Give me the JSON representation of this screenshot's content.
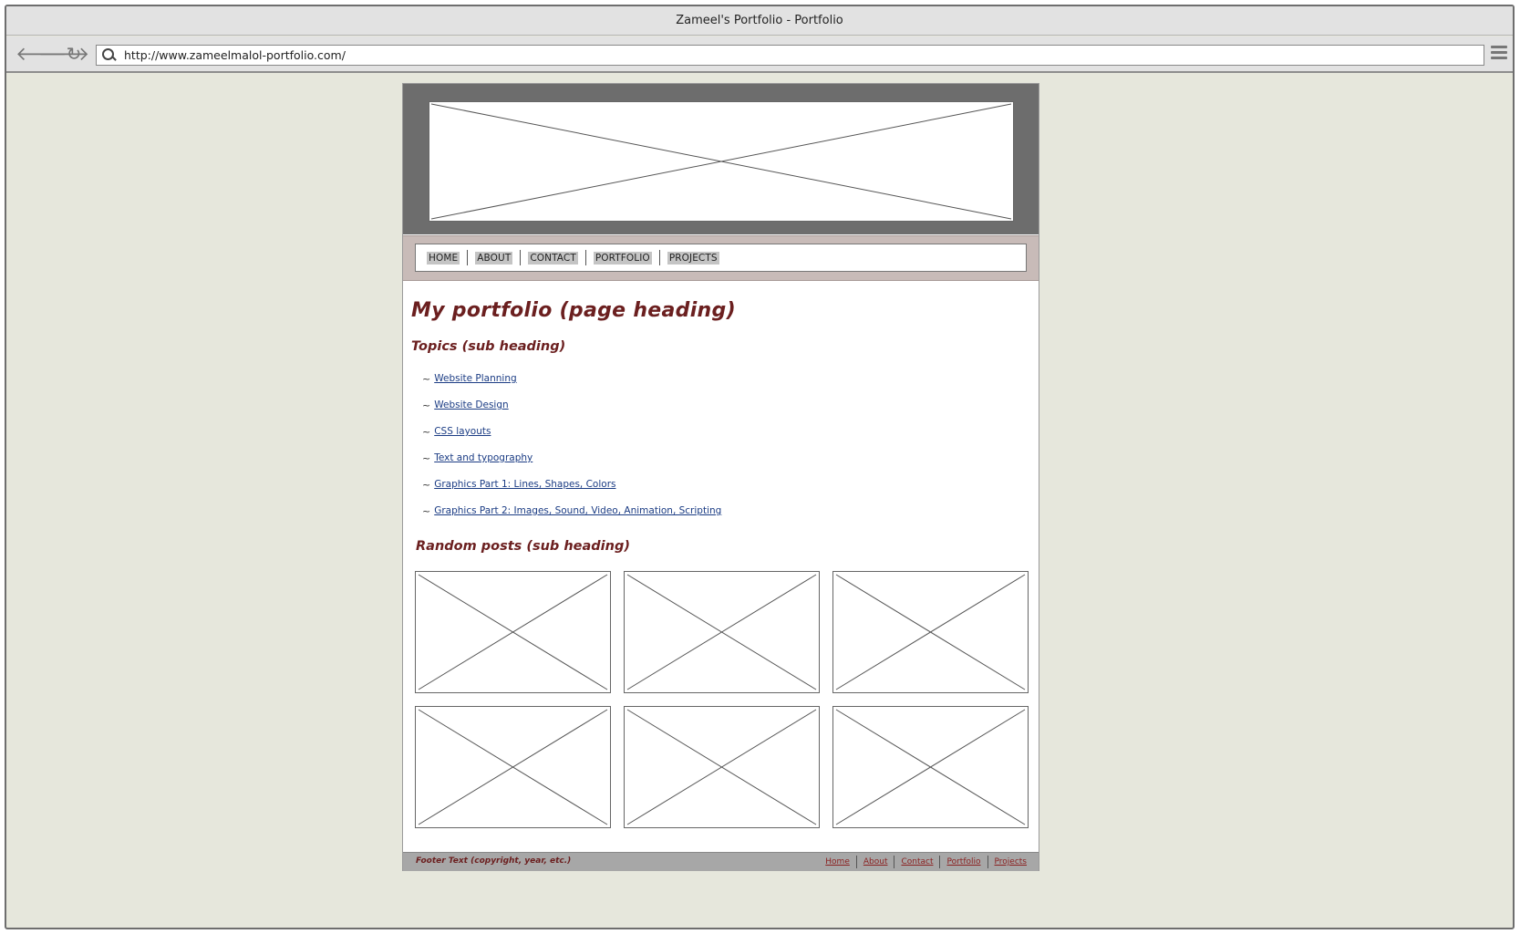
{
  "window": {
    "title": "Zameel's Portfolio - Portfolio"
  },
  "toolbar": {
    "url": "http://www.zameelmalol-portfolio.com/",
    "back_icon": "arrow-left-icon",
    "forward_icon": "arrow-right-icon",
    "reload_icon": "reload-icon",
    "menu_icon": "hamburger-menu-icon"
  },
  "nav": {
    "items": [
      {
        "label": "HOME"
      },
      {
        "label": "ABOUT"
      },
      {
        "label": "CONTACT"
      },
      {
        "label": "PORTFOLIO"
      },
      {
        "label": "PROJECTS"
      }
    ]
  },
  "main": {
    "heading": "My portfolio (page heading)",
    "topics_heading": "Topics (sub heading)",
    "topics": [
      {
        "bullet": "~",
        "label": "Website Planning"
      },
      {
        "bullet": "~",
        "label": "Website Design"
      },
      {
        "bullet": "~",
        "label": "CSS layouts"
      },
      {
        "bullet": "~",
        "label": "Text and typography"
      },
      {
        "bullet": "~",
        "label": "Graphics Part 1: Lines, Shapes, Colors"
      },
      {
        "bullet": "~",
        "label": "Graphics Part 2: Images, Sound, Video, Animation, Scripting"
      }
    ],
    "posts_heading": "Random posts (sub heading)"
  },
  "footer": {
    "text": "Footer Text (copyright, year, etc.)",
    "links": [
      {
        "label": "Home"
      },
      {
        "label": "About"
      },
      {
        "label": "Contact"
      },
      {
        "label": "Portfolio"
      },
      {
        "label": "Projects"
      }
    ]
  },
  "colors": {
    "background": "#e6e7dc",
    "header": "#6d6d6d",
    "nav_bar": "#c8bbb8",
    "heading": "#6b1f1f",
    "link": "#1b3c84",
    "footer": "#a7a7a7"
  }
}
